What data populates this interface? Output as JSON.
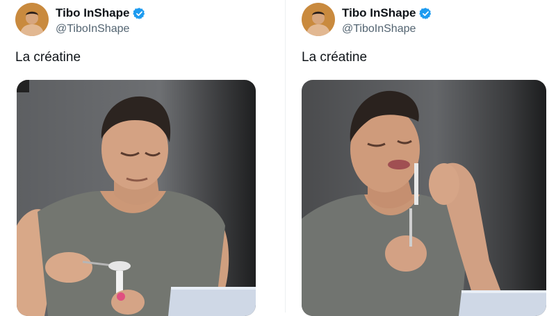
{
  "tweets": [
    {
      "author": {
        "name": "Tibo InShape",
        "handle": "@TiboInShape",
        "verified": true
      },
      "text": "La créatine",
      "media": {
        "type": "photo"
      }
    },
    {
      "author": {
        "name": "Tibo InShape",
        "handle": "@TiboInShape",
        "verified": true
      },
      "text": "La créatine",
      "media": {
        "type": "photo"
      }
    }
  ],
  "colors": {
    "verified_badge": "#1d9bf0",
    "name_text": "#0f1419",
    "handle_text": "#536471"
  },
  "icons": {
    "verified": "verified-badge-icon"
  }
}
